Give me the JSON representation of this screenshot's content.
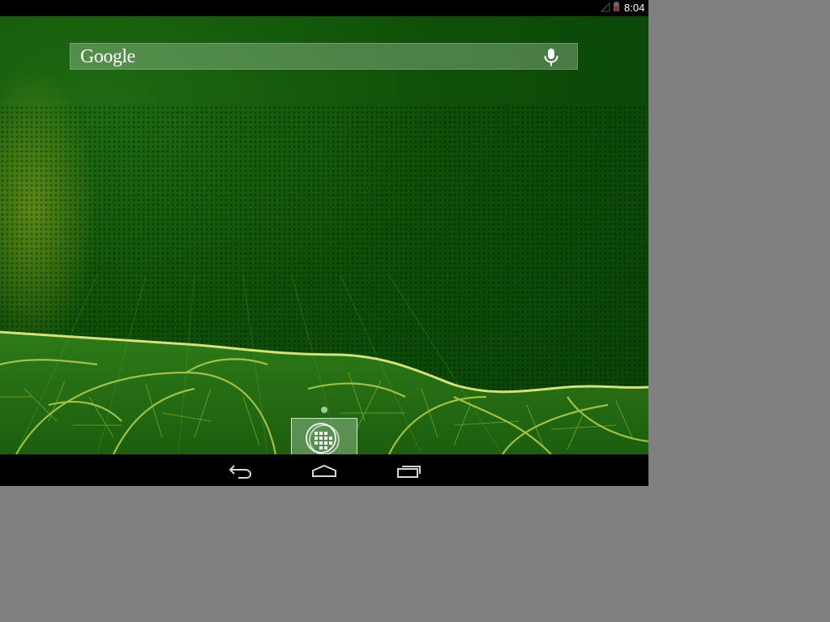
{
  "status_bar": {
    "time": "8:04",
    "signal_icon": "signal-strength-icon",
    "battery_icon": "battery-icon"
  },
  "search_bar": {
    "logo_text": "Google",
    "mic_icon": "microphone-icon"
  },
  "home_screen": {
    "page_indicator_icon": "page-indicator-dot",
    "all_apps_icon": "all-apps-grid-icon"
  },
  "nav_bar": {
    "back_icon": "back-icon",
    "home_icon": "home-icon",
    "recents_icon": "recent-apps-icon"
  },
  "colors": {
    "wallpaper_green": "#0f4f08",
    "leaf_vein": "#c8d860",
    "bar_background": "#000000",
    "desktop_background": "#808080"
  }
}
